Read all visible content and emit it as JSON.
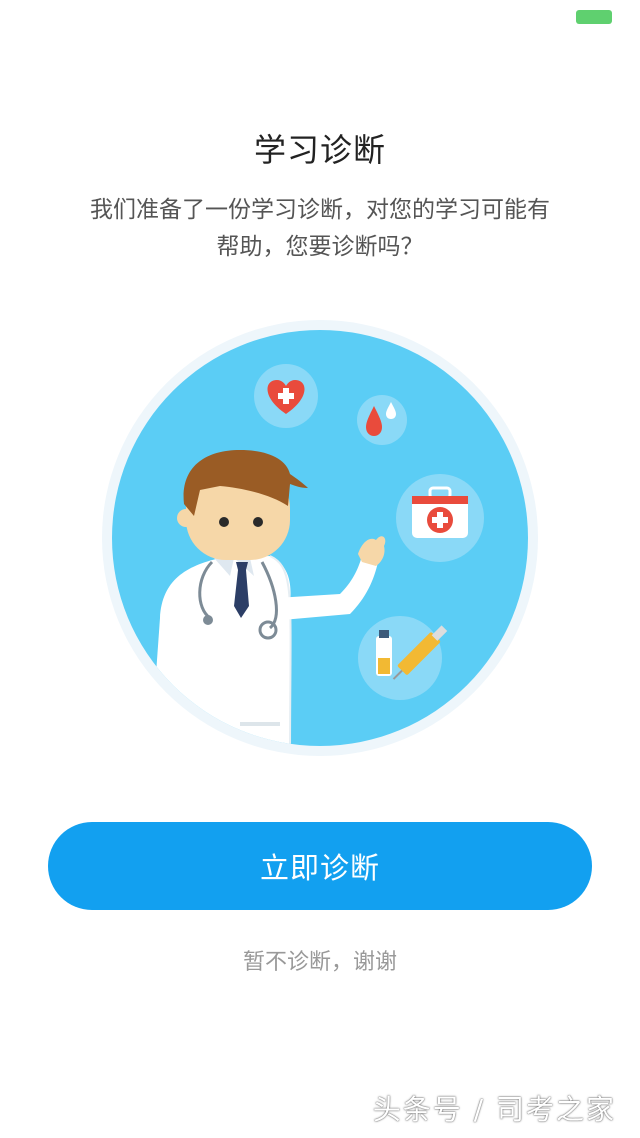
{
  "status_bar": {
    "battery_color": "#5fd06f"
  },
  "page": {
    "title": "学习诊断",
    "description": "我们准备了一份学习诊断，对您的学习可能有帮助，您要诊断吗？"
  },
  "illustration": {
    "subject": "doctor",
    "icons": [
      "heart-plus-icon",
      "blood-drop-icon",
      "first-aid-kit-icon",
      "vial-syringe-icon"
    ],
    "colors": {
      "circle": "#5bcdf5",
      "ring": "#eef6fb",
      "accent": "#e94b3c"
    }
  },
  "actions": {
    "primary_label": "立即诊断",
    "secondary_label": "暂不诊断，谢谢"
  },
  "watermark": {
    "text": "头条号 / 司考之家"
  },
  "colors": {
    "primary": "#12a0f0",
    "secondary_text": "#999999"
  }
}
